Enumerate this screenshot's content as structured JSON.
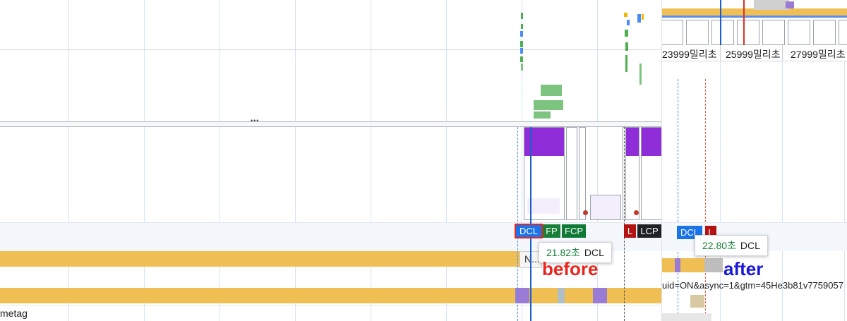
{
  "ruler": {
    "ticks": [
      "23999밀리초",
      "25999밀리초",
      "27999밀리초"
    ]
  },
  "markers_before": {
    "dcl": "DCL",
    "fp": "FP",
    "fcp": "FCP",
    "l": "L",
    "lcp": "LCP"
  },
  "markers_after": {
    "dcl": "DCL",
    "l": "L"
  },
  "tooltip_before": {
    "value": "21.82초",
    "label": "DCL"
  },
  "tooltip_after": {
    "value": "22.80초",
    "label": "DCL"
  },
  "annotations": {
    "before": "before",
    "after": "after"
  },
  "track_labels": {
    "network_request": "N...",
    "url": "uid=ON&async=1&gtm=45He3b81v7759057",
    "bottom_left": "metag"
  },
  "resize_handle": "•••",
  "colors": {
    "dcl": "#1a73e8",
    "fp": "#188038",
    "fcp": "#0f7a36",
    "load": "#b31412",
    "lcp": "#202124",
    "bar": "#f0bf53",
    "purple": "#8f2ed8",
    "before_text": "#e8251e",
    "after_text": "#1a1ad8"
  }
}
